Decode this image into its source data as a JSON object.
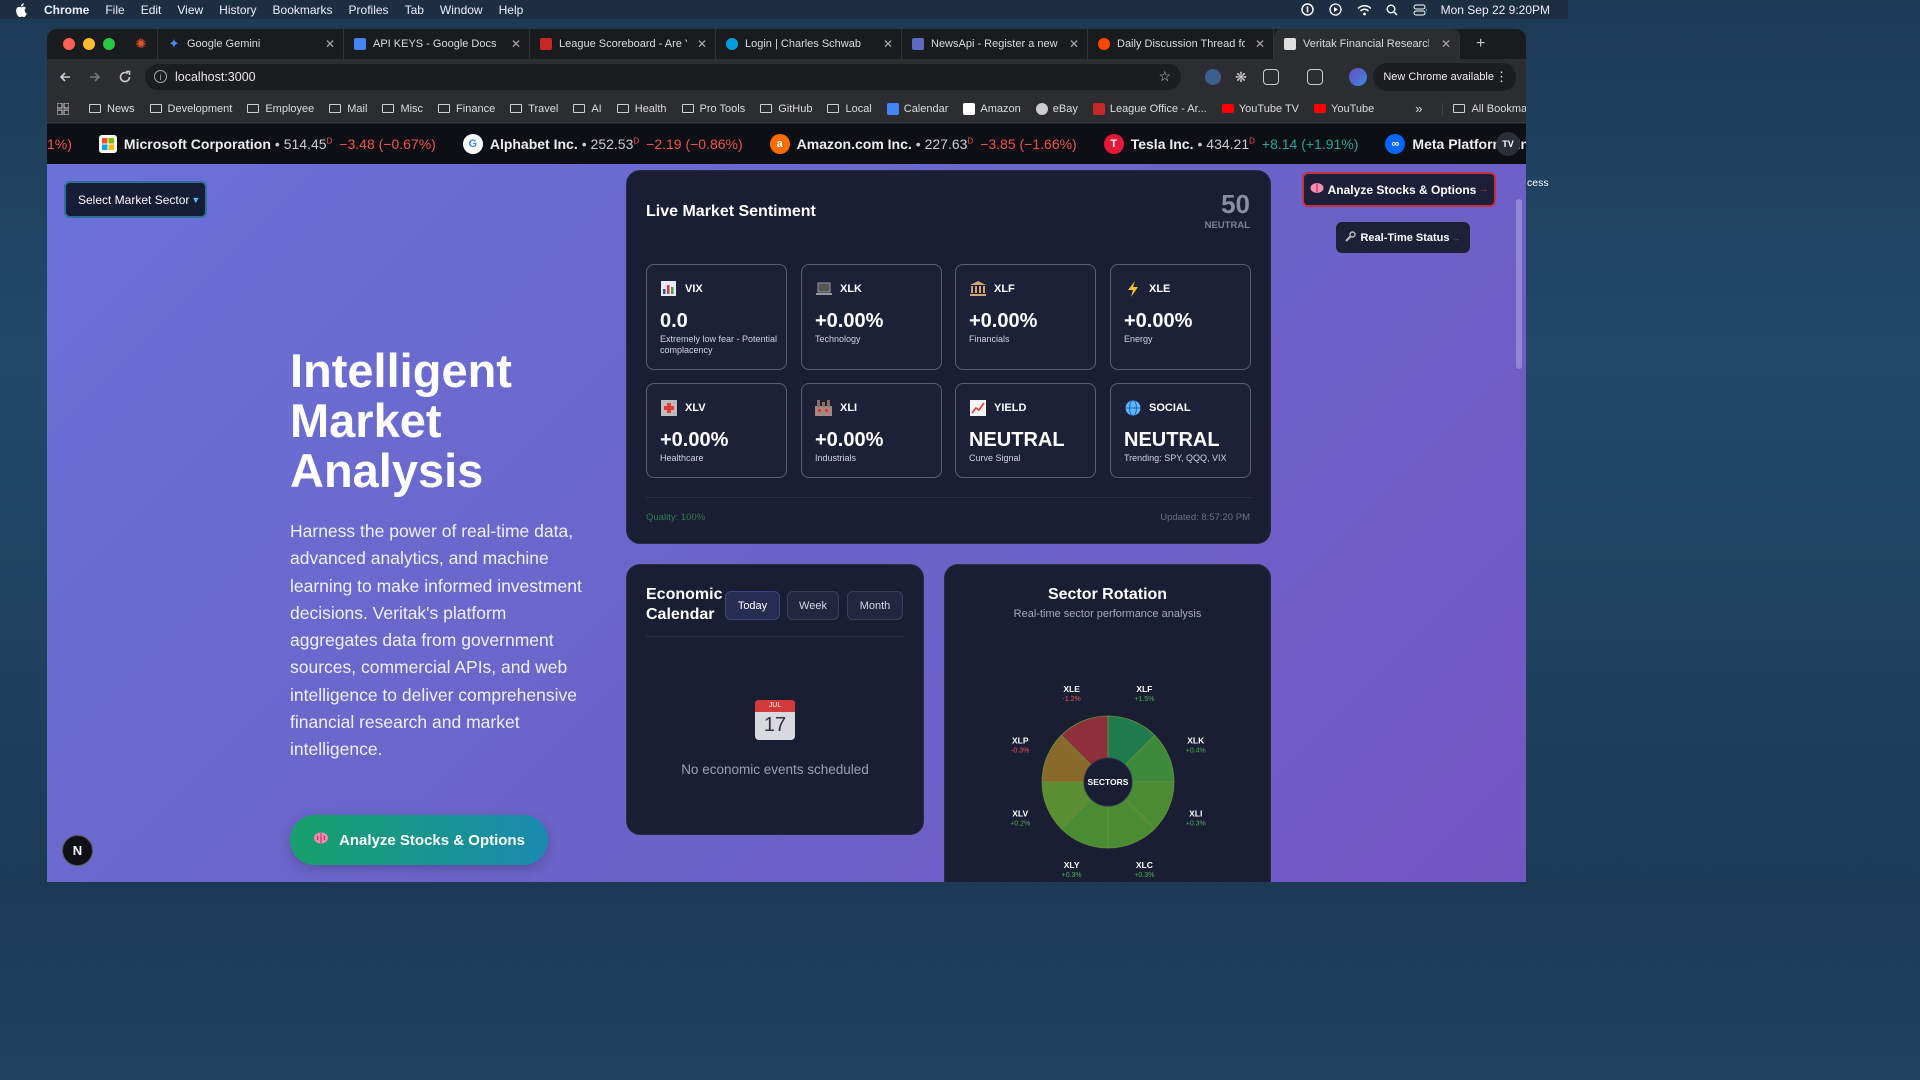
{
  "menubar": {
    "app": "Chrome",
    "items": [
      "File",
      "Edit",
      "View",
      "History",
      "Bookmarks",
      "Profiles",
      "Tab",
      "Window",
      "Help"
    ],
    "datetime": "Mon Sep 22  9:20PM"
  },
  "tabs": [
    {
      "title": "",
      "color": "#e8542a"
    },
    {
      "title": "Google Gemini",
      "color": "#4a8af4"
    },
    {
      "title": "API KEYS - Google Docs",
      "color": "#4285f4"
    },
    {
      "title": "League Scoreboard - Are Yo",
      "color": "#c62828"
    },
    {
      "title": "Login | Charles Schwab",
      "color": "#00a0df"
    },
    {
      "title": "NewsApi - Register a new a",
      "color": "#5c6bc0"
    },
    {
      "title": "Daily Discussion Thread for",
      "color": "#ff4500"
    },
    {
      "title": "Veritak Financial Research I",
      "color": "#e0e0e0"
    }
  ],
  "address": {
    "url": "localhost:3000",
    "new_chrome": "New Chrome available"
  },
  "bookmarks": [
    {
      "label": "News",
      "type": "folder"
    },
    {
      "label": "Development",
      "type": "folder"
    },
    {
      "label": "Employee",
      "type": "folder"
    },
    {
      "label": "Mail",
      "type": "folder"
    },
    {
      "label": "Misc",
      "type": "folder"
    },
    {
      "label": "Finance",
      "type": "folder"
    },
    {
      "label": "Travel",
      "type": "folder"
    },
    {
      "label": "AI",
      "type": "folder"
    },
    {
      "label": "Health",
      "type": "folder"
    },
    {
      "label": "Pro Tools",
      "type": "folder"
    },
    {
      "label": "GitHub",
      "type": "folder"
    },
    {
      "label": "Local",
      "type": "folder"
    },
    {
      "label": "Calendar",
      "type": "site",
      "color": "#4285f4"
    },
    {
      "label": "Amazon",
      "type": "site",
      "color": "#ffffff"
    },
    {
      "label": "eBay",
      "type": "site",
      "color": "#cccccc"
    },
    {
      "label": "League Office - Ar...",
      "type": "site",
      "color": "#c62828"
    },
    {
      "label": "YouTube TV",
      "type": "site",
      "color": "#ff0000"
    },
    {
      "label": "YouTube",
      "type": "site",
      "color": "#ff0000"
    }
  ],
  "all_bookmarks": "All Bookmarks",
  "ticker": {
    "lead": "1%)",
    "items": [
      {
        "name": "Microsoft Corporation",
        "price": "514.45",
        "change": "−3.48 (−0.67%)",
        "dir": "neg",
        "logo": "#f25022",
        "glyph": "▦"
      },
      {
        "name": "Alphabet Inc.",
        "price": "252.53",
        "change": "−2.19 (−0.86%)",
        "dir": "neg",
        "logo": "#ffffff",
        "glyph": "G"
      },
      {
        "name": "Amazon.com Inc.",
        "price": "227.63",
        "change": "−3.85 (−1.66%)",
        "dir": "neg",
        "logo": "#ff6d00",
        "glyph": "a"
      },
      {
        "name": "Tesla Inc.",
        "price": "434.21",
        "change": "+8.14 (+1.91%)",
        "dir": "pos",
        "logo": "#e31937",
        "glyph": "T"
      },
      {
        "name": "Meta Platforms In",
        "price": "",
        "change": "",
        "dir": "pos",
        "logo": "#0866ff",
        "glyph": "∞"
      }
    ]
  },
  "page": {
    "sector_select": "Select Market Sector",
    "hero_title": "Intelligent Market Analysis",
    "hero_desc": "Harness the power of real-time data, advanced analytics, and machine learning to make informed investment decisions. Veritak's platform aggregates data from government sources, commercial APIs, and web intelligence to deliver comprehensive financial research and market intelligence.",
    "hero_button": "Analyze Stocks & Options",
    "analyze_top": "Analyze Stocks & Options",
    "realtime": "Real-Time Status",
    "cut_text": "cess"
  },
  "sentiment": {
    "title": "Live Market Sentiment",
    "score": "50",
    "label": "NEUTRAL",
    "tiles": [
      {
        "name": "VIX",
        "value": "0.0",
        "sub": "Extremely low fear - Potential complacency",
        "icon": "bar-chart-icon",
        "icolor": "#4fc3f7"
      },
      {
        "name": "XLK",
        "value": "+0.00%",
        "sub": "Technology",
        "icon": "laptop-icon",
        "icolor": "#9e9e9e"
      },
      {
        "name": "XLF",
        "value": "+0.00%",
        "sub": "Financials",
        "icon": "bank-icon",
        "icolor": "#d4a373"
      },
      {
        "name": "XLE",
        "value": "+0.00%",
        "sub": "Energy",
        "icon": "lightning-icon",
        "icolor": "#fbc02d"
      },
      {
        "name": "XLV",
        "value": "+0.00%",
        "sub": "Healthcare",
        "icon": "hospital-icon",
        "icolor": "#e57373"
      },
      {
        "name": "XLI",
        "value": "+0.00%",
        "sub": "Industrials",
        "icon": "factory-icon",
        "icolor": "#a1887f"
      },
      {
        "name": "YIELD",
        "value": "NEUTRAL",
        "sub": "Curve Signal",
        "icon": "trend-chart-icon",
        "icolor": "#ef5350"
      },
      {
        "name": "SOCIAL",
        "value": "NEUTRAL",
        "sub": "Trending: SPY, QQQ, VIX",
        "icon": "globe-icon",
        "icolor": "#64b5f6"
      }
    ],
    "quality": "Quality: 100%",
    "updated": "Updated: 8:57:20 PM"
  },
  "economic": {
    "title": "Economic Calendar",
    "tabs": [
      "Today",
      "Week",
      "Month"
    ],
    "active": "Today",
    "cal_month": "JUL",
    "cal_day": "17",
    "empty": "No economic events scheduled"
  },
  "rotation": {
    "title": "Sector Rotation",
    "subtitle": "Real-time sector performance analysis",
    "center": "SECTORS",
    "sectors": [
      {
        "name": "XLF",
        "change": "+1.5%",
        "color": "#1f7a4d",
        "dir": "pos"
      },
      {
        "name": "XLK",
        "change": "+0.4%",
        "color": "#3d8a3a",
        "dir": "pos"
      },
      {
        "name": "XLI",
        "change": "+0.3%",
        "color": "#4a8c34",
        "dir": "pos"
      },
      {
        "name": "XLC",
        "change": "+0.3%",
        "color": "#4a8c34",
        "dir": "pos"
      },
      {
        "name": "XLY",
        "change": "+0.3%",
        "color": "#4a8c34",
        "dir": "pos"
      },
      {
        "name": "XLV",
        "change": "+0.2%",
        "color": "#5a8e30",
        "dir": "pos"
      },
      {
        "name": "XLP",
        "change": "-0.3%",
        "color": "#8a6a2a",
        "dir": "neg"
      },
      {
        "name": "XLE",
        "change": "-1.2%",
        "color": "#8f2f3b",
        "dir": "neg"
      }
    ]
  }
}
